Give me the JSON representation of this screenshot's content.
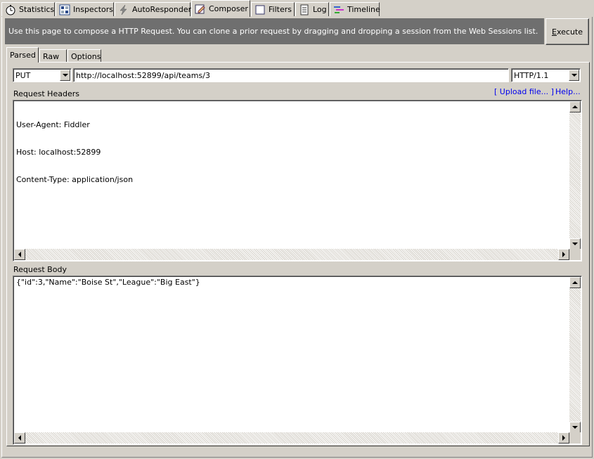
{
  "tabs": [
    {
      "label": "Statistics",
      "icon": "stopwatch-icon"
    },
    {
      "label": "Inspectors",
      "icon": "inspectors-icon"
    },
    {
      "label": "AutoResponder",
      "icon": "lightning-icon"
    },
    {
      "label": "Composer",
      "icon": "composer-icon"
    },
    {
      "label": "Filters",
      "icon": "checkbox-icon"
    },
    {
      "label": "Log",
      "icon": "log-icon"
    },
    {
      "label": "Timeline",
      "icon": "timeline-icon"
    }
  ],
  "info": {
    "text": "Use this page to compose a HTTP Request. You can clone a prior request by dragging and dropping a session from the Web Sessions list.",
    "execute_prefix": "E",
    "execute_rest": "xecute"
  },
  "inner_tabs": [
    "Parsed",
    "Raw",
    "Options"
  ],
  "request": {
    "method": "PUT",
    "url": "http://localhost:52899/api/teams/3",
    "version": "HTTP/1.1"
  },
  "headers_section": {
    "label": "Request Headers",
    "upload_link": "[ Upload file... ]",
    "help_link": "Help...",
    "lines": [
      "User-Agent: Fiddler",
      "Host: localhost:52899",
      "Content-Type: application/json"
    ]
  },
  "body_section": {
    "label": "Request Body",
    "content": "{\"id\":3,\"Name\":\"Boise St\",\"League\":\"Big East\"}"
  },
  "colors": {
    "chrome": "#d4d0c8",
    "infobar": "#6f6f6f",
    "link": "#0000ee"
  }
}
